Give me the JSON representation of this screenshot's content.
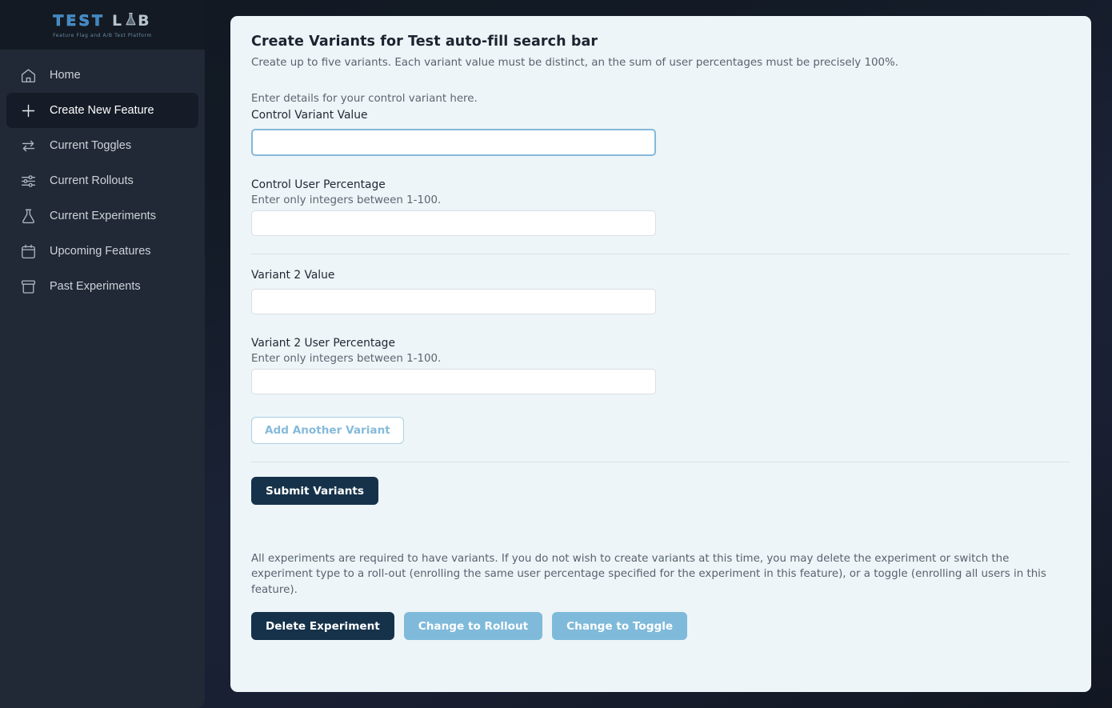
{
  "sidebar": {
    "logo": {
      "part1": "TEST",
      "part2_l": "L",
      "part2_b": "B",
      "subtitle": "Feature Flag and A/B Test Platform",
      "flask_icon": "flask-icon"
    },
    "items": [
      {
        "label": "Home",
        "icon": "home-icon",
        "active": false
      },
      {
        "label": "Create New Feature",
        "icon": "plus-icon",
        "active": true
      },
      {
        "label": "Current Toggles",
        "icon": "swap-arrows-icon",
        "active": false
      },
      {
        "label": "Current Rollouts",
        "icon": "sliders-icon",
        "active": false
      },
      {
        "label": "Current Experiments",
        "icon": "flask-icon",
        "active": false
      },
      {
        "label": "Upcoming Features",
        "icon": "calendar-icon",
        "active": false
      },
      {
        "label": "Past Experiments",
        "icon": "archive-icon",
        "active": false
      }
    ]
  },
  "main": {
    "title": "Create Variants for Test auto-fill search bar",
    "subtitle": "Create up to five variants. Each variant value must be distinct, an the sum of user percentages must be precisely 100%.",
    "control_intro": "Enter details for your control variant here.",
    "fields": {
      "control_value": {
        "label": "Control Variant Value",
        "value": "",
        "placeholder": "",
        "focused": true
      },
      "control_percentage": {
        "label": "Control User Percentage",
        "helper": "Enter only integers between 1-100.",
        "value": "",
        "placeholder": ""
      },
      "variant2_value": {
        "label": "Variant 2 Value",
        "value": "",
        "placeholder": ""
      },
      "variant2_percentage": {
        "label": "Variant 2 User Percentage",
        "helper": "Enter only integers between 1-100.",
        "value": "",
        "placeholder": ""
      }
    },
    "add_variant_label": "Add Another Variant",
    "submit_label": "Submit Variants",
    "bottom_note": "All experiments are required to have variants. If you do not wish to create variants at this time, you may delete the experiment or switch the experiment type to a roll-out (enrolling the same user percentage specified for the experiment in this feature), or a toggle (enrolling all users in this feature).",
    "delete_label": "Delete Experiment",
    "change_rollout_label": "Change to Rollout",
    "change_toggle_label": "Change to Toggle"
  },
  "colors": {
    "sidebar_bg": "#131a23",
    "nav_bg": "#212936",
    "nav_active_bg": "#151c27",
    "panel_bg": "#eef5f8",
    "accent_dark": "#16324a",
    "accent_blue": "#7fbada",
    "logo_blue": "#3f86c4",
    "focus_border": "#84b9d8"
  }
}
